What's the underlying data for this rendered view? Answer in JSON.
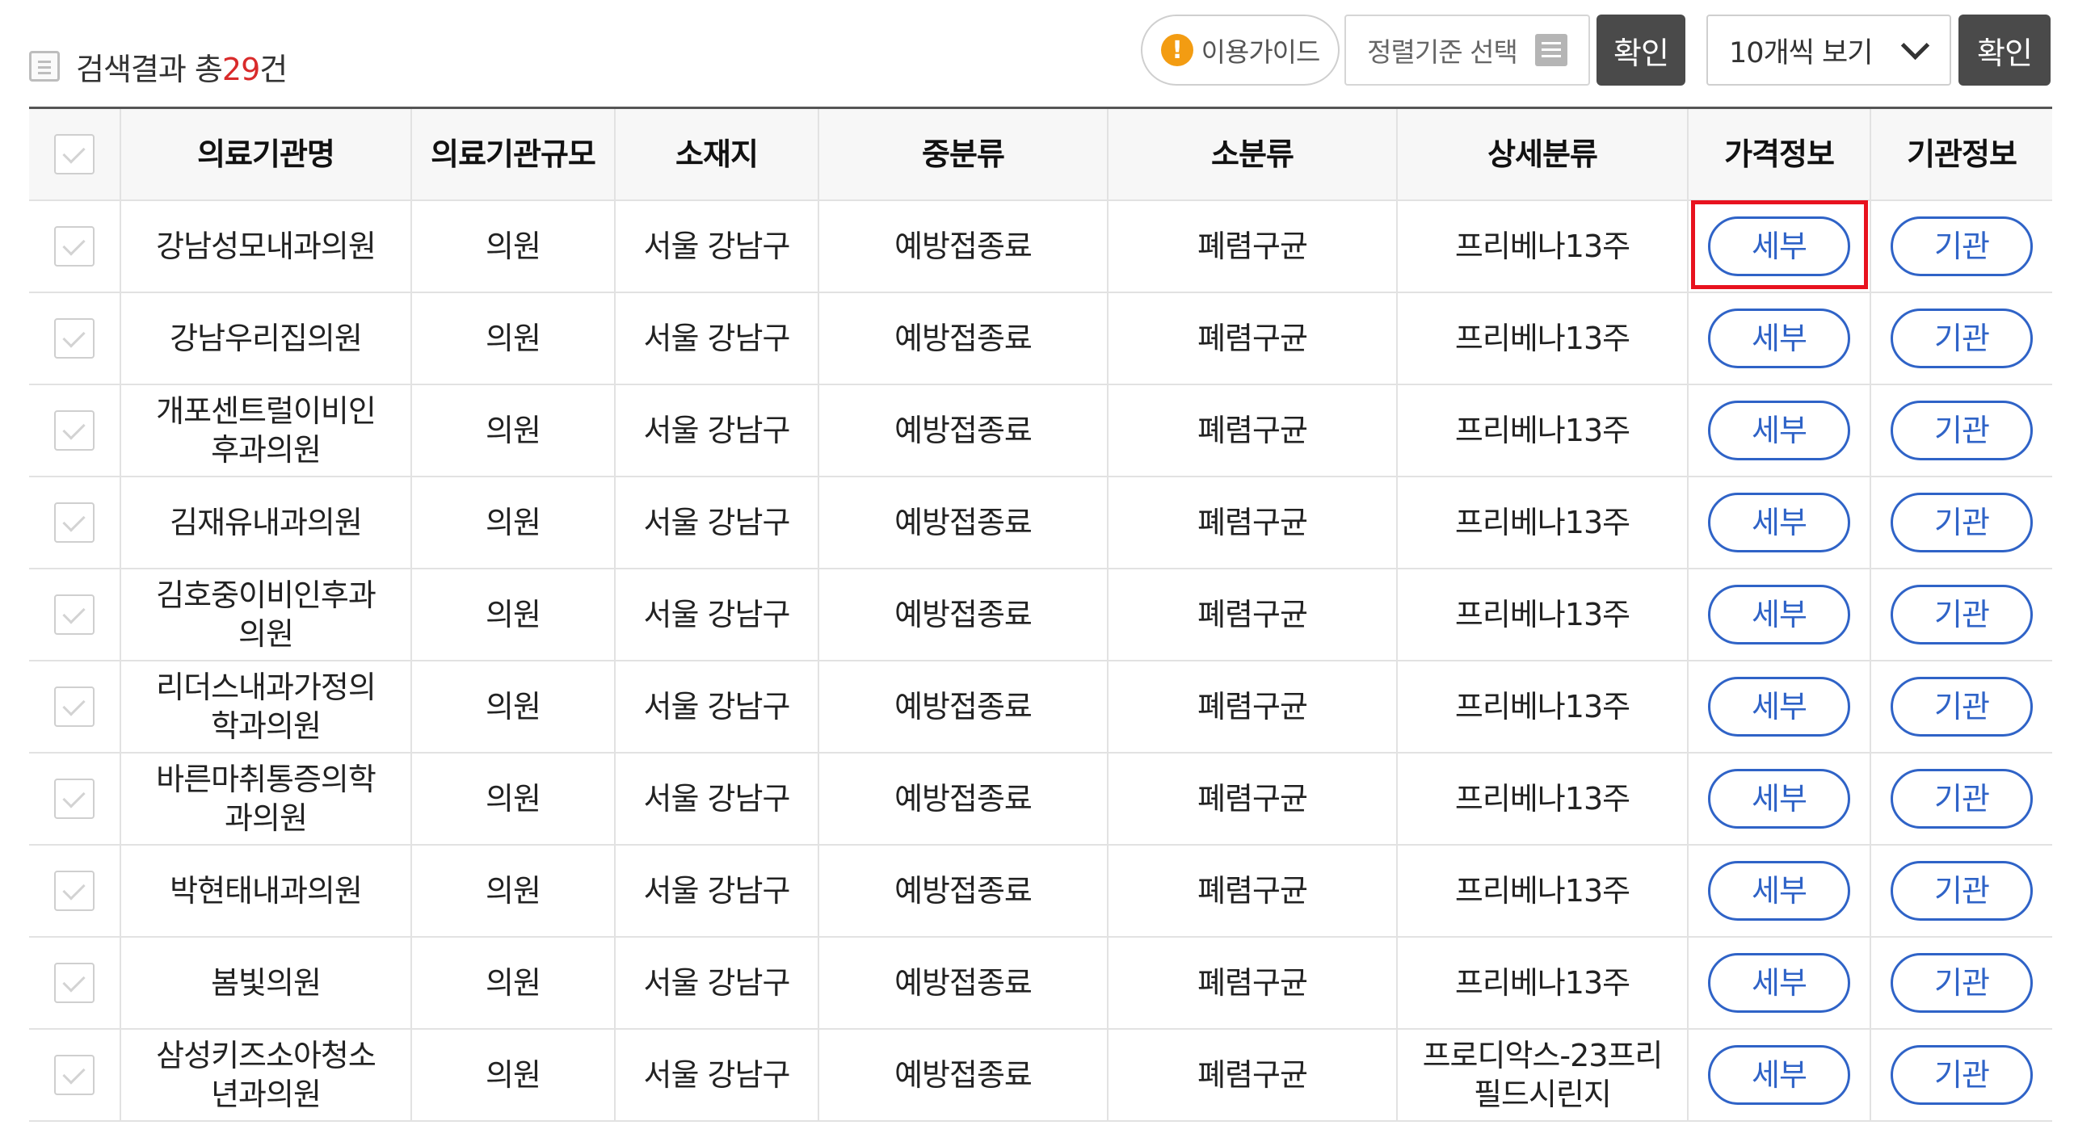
{
  "summary": {
    "prefix": "검색결과 총",
    "count": "29",
    "suffix": "건"
  },
  "toolbar": {
    "guide_label": "이용가이드",
    "sort_label": "정렬기준 선택",
    "confirm_label": "확인",
    "page_size_value": "10개씩 보기",
    "confirm2_label": "확인"
  },
  "table": {
    "headers": [
      "의료기관명",
      "의료기관규모",
      "소재지",
      "중분류",
      "소분류",
      "상세분류",
      "가격정보",
      "기관정보"
    ],
    "rows": [
      {
        "name": "강남성모내과의원",
        "scale": "의원",
        "location": "서울 강남구",
        "mid": "예방접종료",
        "sub": "폐렴구균",
        "detail": "프리베나13주",
        "price_btn": "세부",
        "inst_btn": "기관"
      },
      {
        "name": "강남우리집의원",
        "scale": "의원",
        "location": "서울 강남구",
        "mid": "예방접종료",
        "sub": "폐렴구균",
        "detail": "프리베나13주",
        "price_btn": "세부",
        "inst_btn": "기관"
      },
      {
        "name": "개포센트럴이비인\n후과의원",
        "scale": "의원",
        "location": "서울 강남구",
        "mid": "예방접종료",
        "sub": "폐렴구균",
        "detail": "프리베나13주",
        "price_btn": "세부",
        "inst_btn": "기관"
      },
      {
        "name": "김재유내과의원",
        "scale": "의원",
        "location": "서울 강남구",
        "mid": "예방접종료",
        "sub": "폐렴구균",
        "detail": "프리베나13주",
        "price_btn": "세부",
        "inst_btn": "기관"
      },
      {
        "name": "김호중이비인후과\n의원",
        "scale": "의원",
        "location": "서울 강남구",
        "mid": "예방접종료",
        "sub": "폐렴구균",
        "detail": "프리베나13주",
        "price_btn": "세부",
        "inst_btn": "기관"
      },
      {
        "name": "리더스내과가정의\n학과의원",
        "scale": "의원",
        "location": "서울 강남구",
        "mid": "예방접종료",
        "sub": "폐렴구균",
        "detail": "프리베나13주",
        "price_btn": "세부",
        "inst_btn": "기관"
      },
      {
        "name": "바른마취통증의학\n과의원",
        "scale": "의원",
        "location": "서울 강남구",
        "mid": "예방접종료",
        "sub": "폐렴구균",
        "detail": "프리베나13주",
        "price_btn": "세부",
        "inst_btn": "기관"
      },
      {
        "name": "박현태내과의원",
        "scale": "의원",
        "location": "서울 강남구",
        "mid": "예방접종료",
        "sub": "폐렴구균",
        "detail": "프리베나13주",
        "price_btn": "세부",
        "inst_btn": "기관"
      },
      {
        "name": "봄빛의원",
        "scale": "의원",
        "location": "서울 강남구",
        "mid": "예방접종료",
        "sub": "폐렴구균",
        "detail": "프리베나13주",
        "price_btn": "세부",
        "inst_btn": "기관"
      },
      {
        "name": "삼성키즈소아청소\n년과의원",
        "scale": "의원",
        "location": "서울 강남구",
        "mid": "예방접종료",
        "sub": "폐렴구균",
        "detail": "프로디악스-23프리\n필드시린지",
        "price_btn": "세부",
        "inst_btn": "기관"
      }
    ]
  },
  "colors": {
    "accent": "#2f63c7",
    "highlight": "#e8121e",
    "count": "#d92b2b",
    "dark_button": "#4a4a4a"
  }
}
